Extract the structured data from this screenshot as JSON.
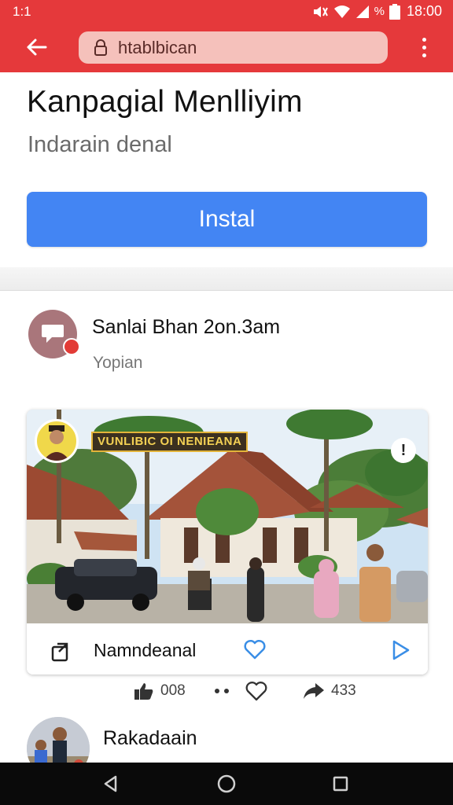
{
  "status_bar": {
    "left_text": "1:1",
    "battery_text": "%",
    "time": "18:00",
    "icons": [
      "mute-icon",
      "wifi-icon",
      "signal-icon",
      "battery-icon"
    ]
  },
  "browser": {
    "url": "htablbican",
    "icons": [
      "back-arrow-icon",
      "lock-icon",
      "overflow-menu-icon"
    ]
  },
  "app": {
    "title": "Kanpagial Menlliyim",
    "subtitle": "Indarain denal",
    "install_label": "Instal"
  },
  "post": {
    "author": "Sanlai Bhan 2on.3am",
    "subtitle": "Yopian",
    "photo_banner": "VUNLIBIC OI NENIEANA",
    "card_label": "Namndeanal",
    "like_count": "008",
    "share_count": "433"
  },
  "second_post": {
    "author": "Rakadaain"
  },
  "colors": {
    "browser_bar": "#e5393b",
    "install_button": "#4385f3",
    "accent_blue": "#3a8ee6"
  }
}
